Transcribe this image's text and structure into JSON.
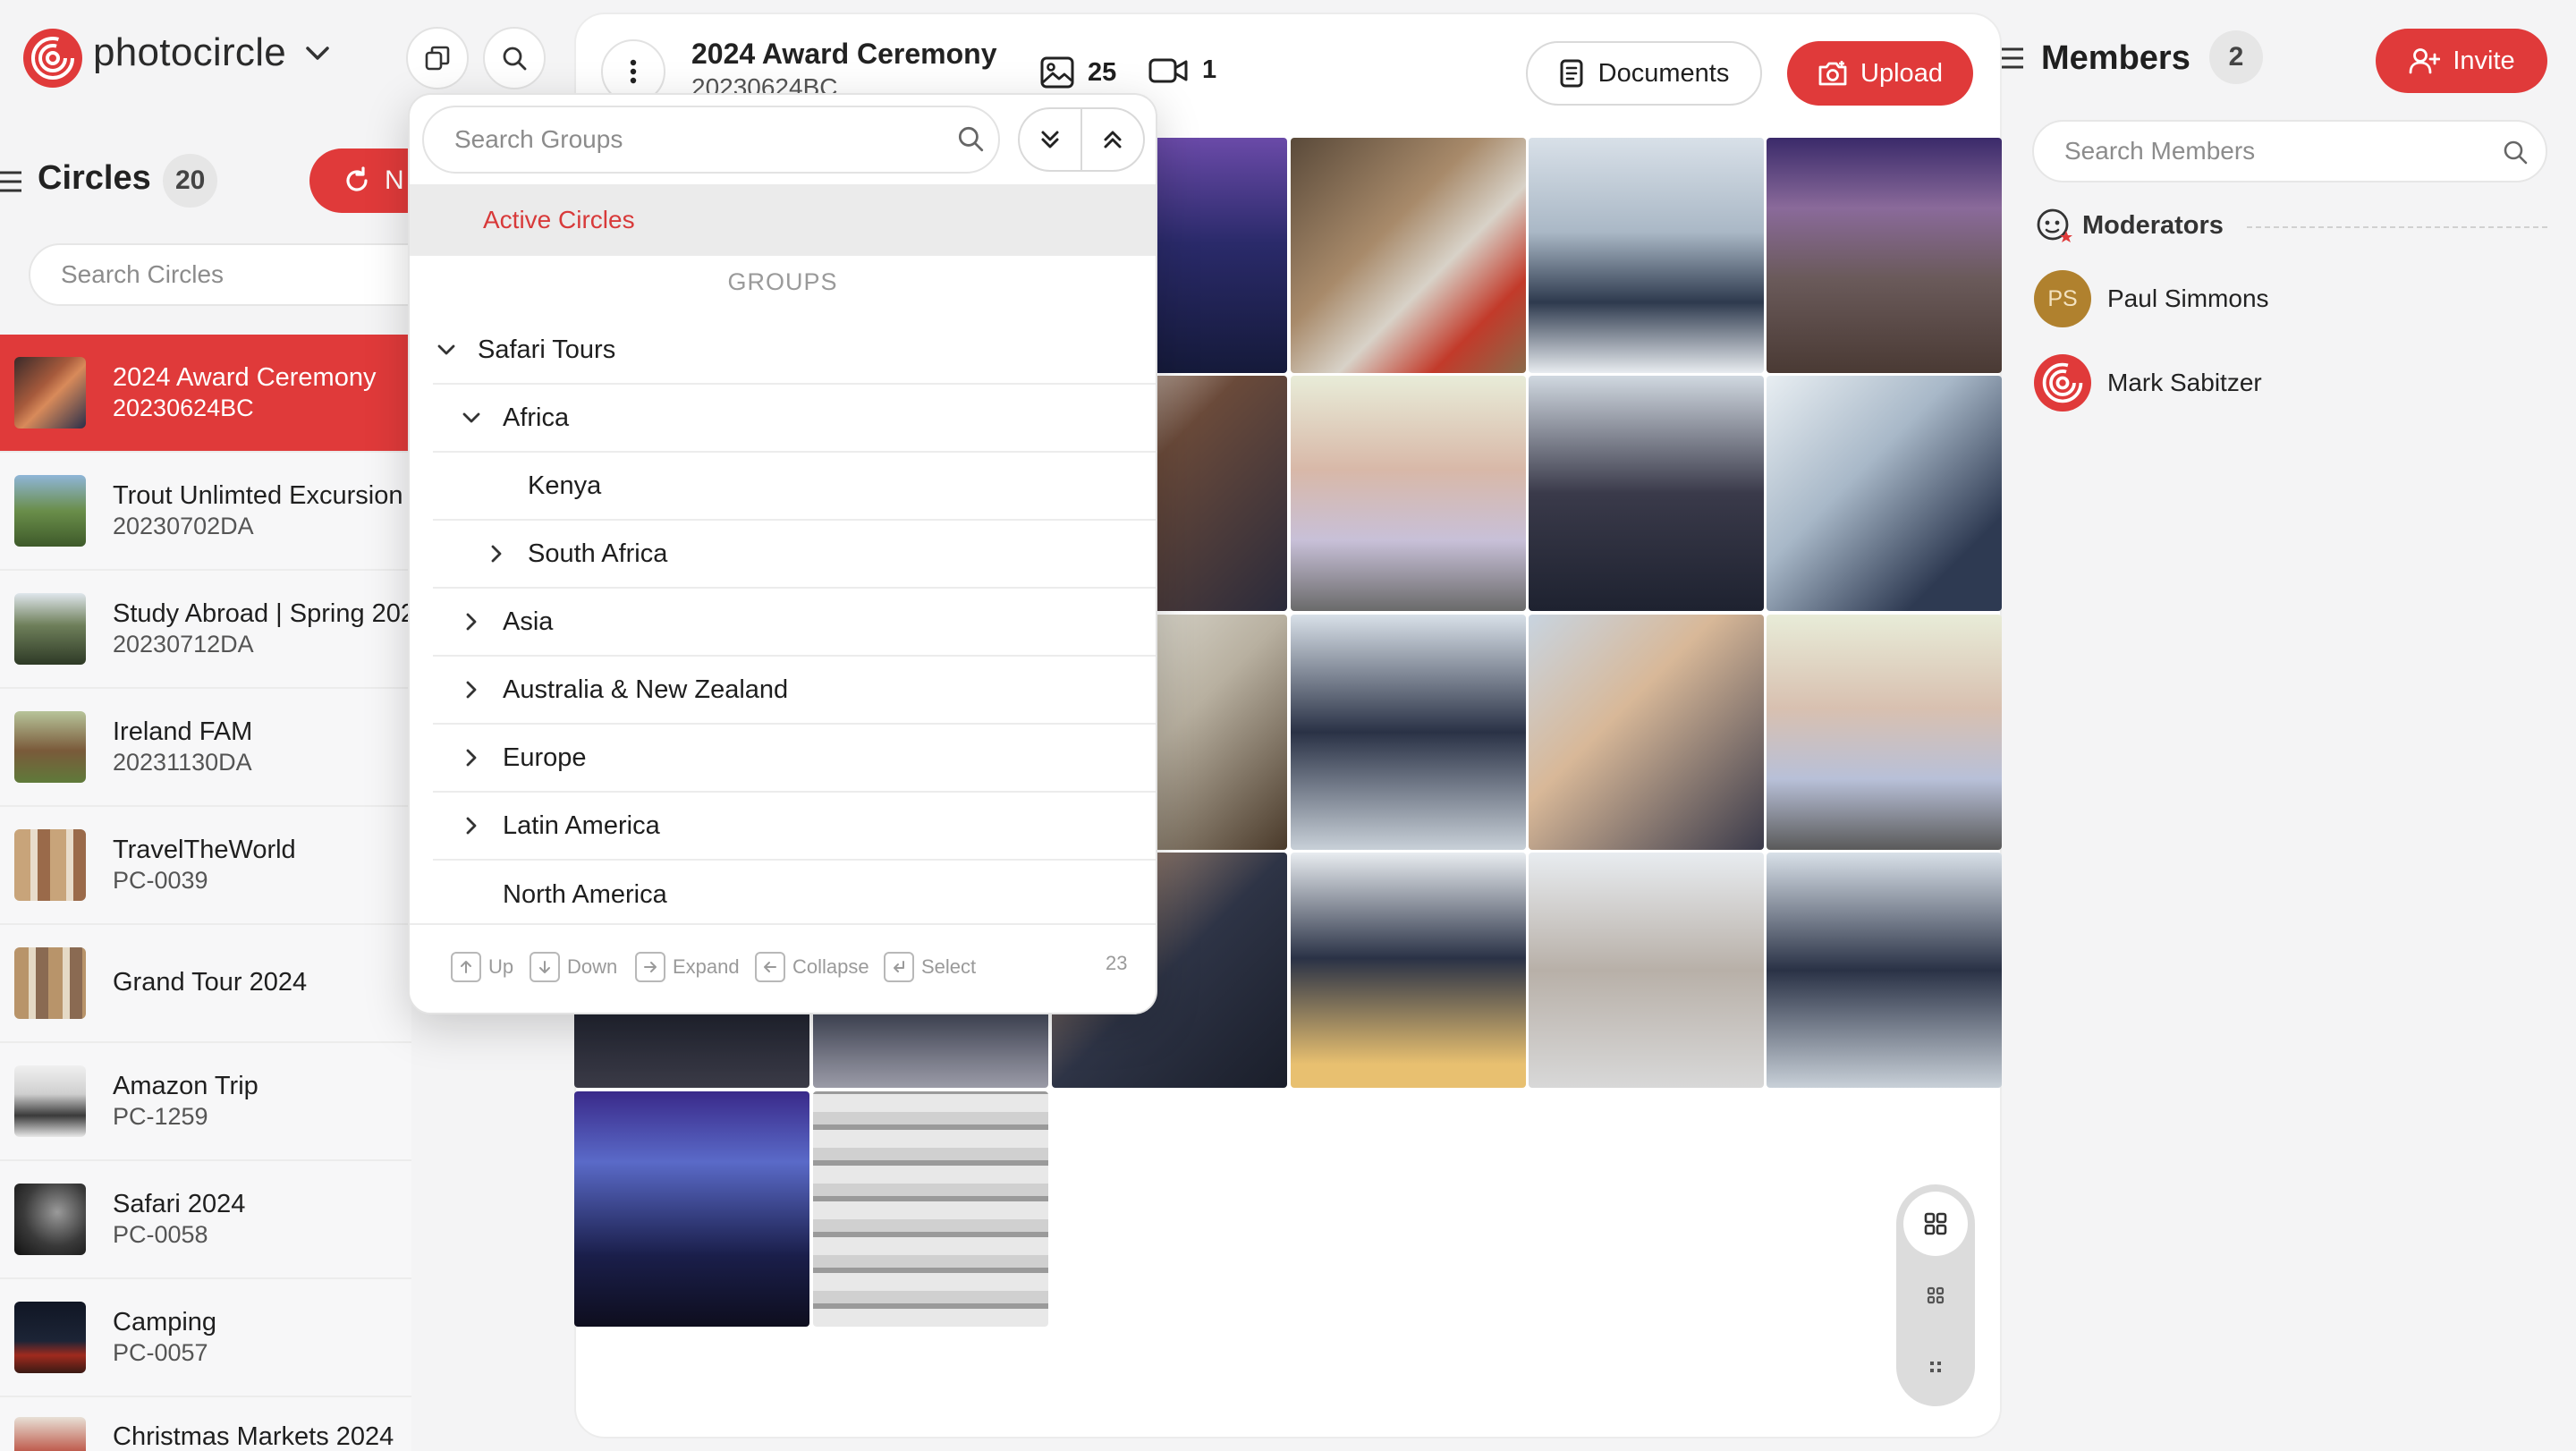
{
  "brand": {
    "name": "photocircle"
  },
  "sidebar": {
    "title": "Circles",
    "count": "20",
    "new_button": "N",
    "search_placeholder": "Search Circles",
    "items": [
      {
        "title": "2024 Award Ceremony",
        "code": "20230624BC",
        "active": true
      },
      {
        "title": "Trout Unlimted Excursion",
        "code": "20230702DA"
      },
      {
        "title": "Study Abroad | Spring 202",
        "code": "20230712DA"
      },
      {
        "title": "Ireland FAM",
        "code": "20231130DA"
      },
      {
        "title": "TravelTheWorld",
        "code": "PC-0039"
      },
      {
        "title": "Grand Tour 2024",
        "code": ""
      },
      {
        "title": "Amazon Trip",
        "code": "PC-1259"
      },
      {
        "title": "Safari 2024",
        "code": "PC-0058"
      },
      {
        "title": "Camping",
        "code": "PC-0057"
      },
      {
        "title": "Christmas Markets 2024",
        "code": ""
      }
    ]
  },
  "header": {
    "title": "2024 Award Ceremony",
    "code": "20230624BC",
    "photo_count": "25",
    "video_count": "1",
    "documents_label": "Documents",
    "upload_label": "Upload"
  },
  "groups_dropdown": {
    "search_placeholder": "Search Groups",
    "active_item": "Active Circles",
    "section_heading": "GROUPS",
    "tree": [
      {
        "label": "Safari Tours",
        "depth": 0,
        "state": "expanded"
      },
      {
        "label": "Africa",
        "depth": 1,
        "state": "expanded"
      },
      {
        "label": "Kenya",
        "depth": 2,
        "state": "leaf"
      },
      {
        "label": "South Africa",
        "depth": 2,
        "state": "collapsed"
      },
      {
        "label": "Asia",
        "depth": 1,
        "state": "collapsed"
      },
      {
        "label": "Australia & New Zealand",
        "depth": 1,
        "state": "collapsed"
      },
      {
        "label": "Europe",
        "depth": 1,
        "state": "collapsed"
      },
      {
        "label": "Latin America",
        "depth": 1,
        "state": "collapsed"
      },
      {
        "label": "North America",
        "depth": 1,
        "state": "leaf"
      }
    ],
    "footer": {
      "up": "Up",
      "down": "Down",
      "expand": "Expand",
      "collapse": "Collapse",
      "select": "Select",
      "count": "23"
    }
  },
  "members": {
    "title": "Members",
    "count": "2",
    "invite_label": "Invite",
    "search_placeholder": "Search Members",
    "moderators_label": "Moderators",
    "list": [
      {
        "initials": "PS",
        "name": "Paul Simmons"
      },
      {
        "initials": "",
        "name": "Mark Sabitzer"
      }
    ]
  },
  "colors": {
    "accent": "#e03a3a",
    "avatar_ps": "#b0812e"
  },
  "icons": [
    "photocircle-logo-icon",
    "chevron-down-icon",
    "copy-icon",
    "search-icon",
    "menu-icon",
    "refresh-icon",
    "kebab-icon",
    "image-icon",
    "video-icon",
    "document-icon",
    "camera-upload-icon",
    "add-user-icon",
    "moderators-icon",
    "chevrons-down-icon",
    "chevrons-up-icon",
    "grid-large-icon",
    "grid-medium-icon",
    "grid-small-icon"
  ]
}
